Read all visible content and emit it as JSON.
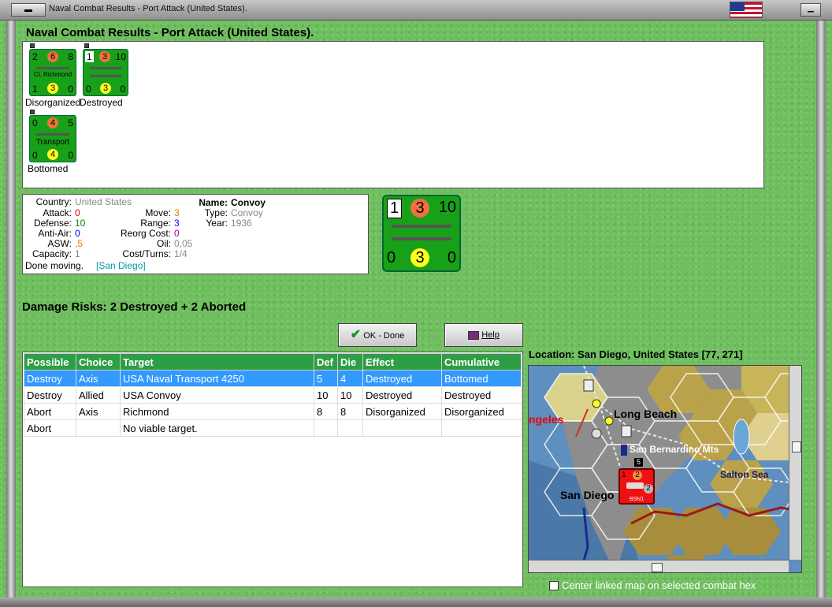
{
  "window": {
    "title": "Naval Combat Results - Port Attack (United States).",
    "system_button": "▬"
  },
  "heading": "Naval Combat Results - Port Attack (United States).",
  "units": [
    {
      "top_left": "2",
      "top_mid": "6",
      "top_right": "8",
      "name": "CL Richmond",
      "bot_left": "1",
      "bot_mid": "3",
      "bot_right": "0",
      "status": "Disorganized"
    },
    {
      "top_left": "1",
      "top_mid": "3",
      "top_right": "10",
      "name": "",
      "bot_left": "0",
      "bot_mid": "3",
      "bot_right": "0",
      "status": "Destroyed"
    },
    {
      "top_left": "0",
      "top_mid": "4",
      "top_right": "5",
      "name": "Transport",
      "bot_left": "0",
      "bot_mid": "4",
      "bot_right": "0",
      "status": "Bottomed"
    }
  ],
  "info": {
    "country_label": "Country:",
    "country": "United States",
    "attack_label": "Attack:",
    "attack": "0",
    "defense_label": "Defense:",
    "defense": "10",
    "antiair_label": "Anti-Air:",
    "antiair": "0",
    "asw_label": "ASW:",
    "asw": ",5",
    "capacity_label": "Capacity:",
    "capacity": "1",
    "move_label": "Move:",
    "move": "3",
    "range_label": "Range:",
    "range": "3",
    "reorg_label": "Reorg Cost:",
    "reorg": "0",
    "oil_label": "Oil:",
    "oil": "0,05",
    "costturns_label": "Cost/Turns:",
    "costturns": "1/4",
    "name_label": "Name:",
    "name": "Convoy",
    "type_label": "Type:",
    "type": "Convoy",
    "year_label": "Year:",
    "year": "1936",
    "done_moving": "Done moving.",
    "done_location": "[San Diego]"
  },
  "big_counter": {
    "top_left": "1",
    "top_mid": "3",
    "top_right": "10",
    "bot_left": "0",
    "bot_mid": "3",
    "bot_right": "0"
  },
  "damage_risks": "Damage Risks:  2 Destroyed + 2 Aborted",
  "buttons": {
    "ok": "OK - Done",
    "help": "Help"
  },
  "table": {
    "headers": [
      "Possible",
      "Choice",
      "Target",
      "Def",
      "Die",
      "Effect",
      "Cumulative"
    ],
    "rows": [
      [
        "Destroy",
        "Axis",
        "USA Naval Transport 4250",
        "5",
        "4",
        "Destroyed",
        "Bottomed"
      ],
      [
        "Destroy",
        "Allied",
        "USA Convoy",
        "10",
        "10",
        "Destroyed",
        "Destroyed"
      ],
      [
        "Abort",
        "Axis",
        "Richmond",
        "8",
        "8",
        "Disorganized",
        "Disorganized"
      ],
      [
        "Abort",
        "",
        "No viable target.",
        "",
        "",
        "",
        ""
      ]
    ]
  },
  "location": "Location:  San Diego, United States [77, 271]",
  "map": {
    "labels": {
      "los_angeles": "ngeles",
      "long_beach": "Long Beach",
      "san_bernardino": "San Bernardino Mts",
      "salton_sea": "Salton Sea",
      "san_diego": "San Diego"
    },
    "unit": {
      "top_left": "1",
      "top_mid": "2",
      "bot_mid": "2",
      "name": "BSN1",
      "stack": "5"
    }
  },
  "center_map_label": "Center linked map on selected combat hex",
  "colors": {
    "counter_green": "#18a018",
    "header_green": "#2e9e46",
    "selection_blue": "#3399ff",
    "axis_red": "#e00000"
  }
}
